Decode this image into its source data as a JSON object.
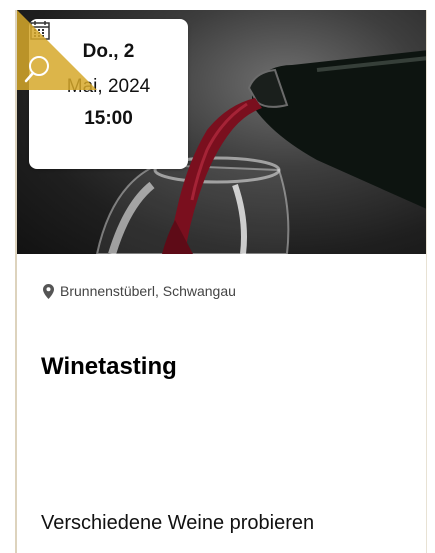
{
  "event": {
    "date_day": "Do., 2",
    "date_month": "Mai, 2024",
    "time": "15:00",
    "location": "Brunnenstüberl, Schwangau",
    "title": "Winetasting",
    "description": "Verschiedene Weine probieren"
  },
  "colors": {
    "accent": "#d6a82a",
    "wine": "#7a0f1e"
  },
  "icons": {
    "calendar": "calendar-icon",
    "search": "search-icon",
    "location": "map-pin-icon"
  }
}
